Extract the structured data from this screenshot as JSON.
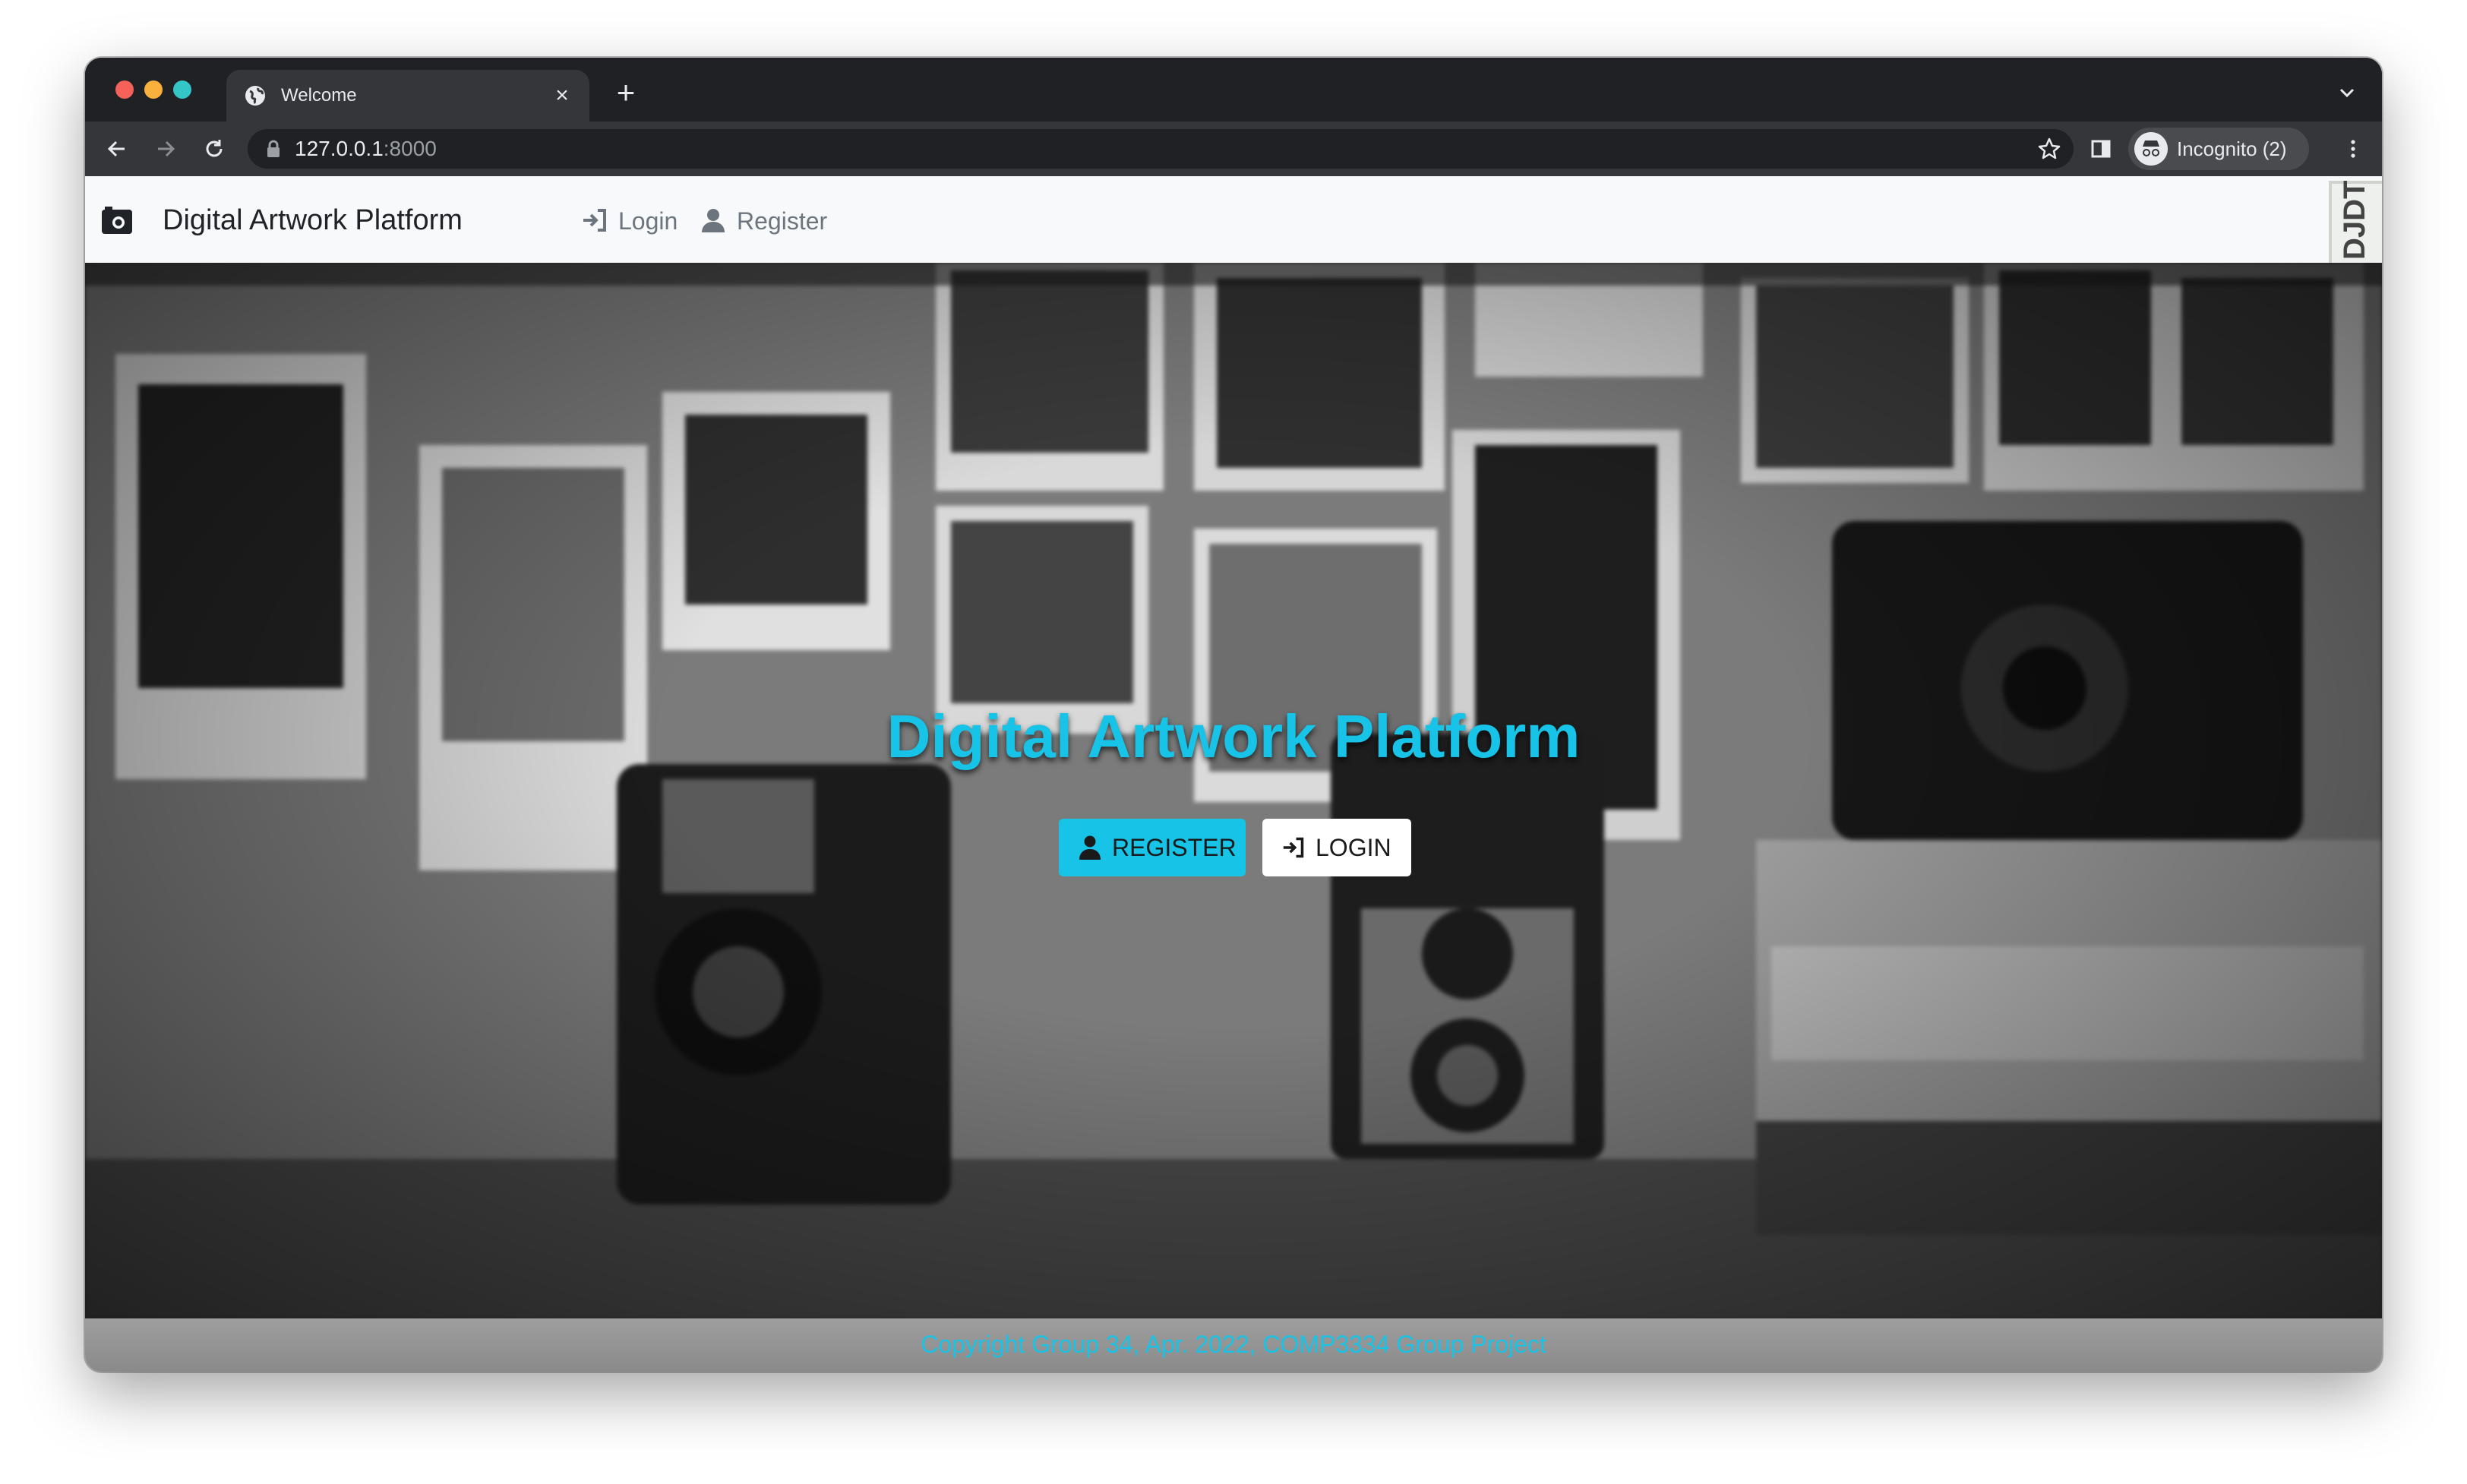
{
  "browser": {
    "tab_title": "Welcome",
    "close_glyph": "×",
    "new_tab_glyph": "+",
    "url_host": "127.0.0.1",
    "url_port": ":8000",
    "profile_label": "Incognito (2)",
    "traffic_colors": [
      "#f6625a",
      "#f9b03c",
      "#34c6c6"
    ]
  },
  "navbar": {
    "brand": "Digital Artwork Platform",
    "login_label": "Login",
    "register_label": "Register",
    "debug_toolbar_label": "DJDT"
  },
  "hero": {
    "title": "Digital Artwork Platform",
    "register_button": "REGISTER",
    "login_button": "LOGIN",
    "background": "blurred black-and-white photo of vintage cameras in front of a wall of pinned photographs"
  },
  "footer": {
    "text": "Copyright Group 34, Apr. 2022, COMP3334 Group Project"
  },
  "colors": {
    "accent": "#17c3e6",
    "navbar_bg": "#f8f9fa",
    "chrome_dark": "#202124",
    "chrome_toolbar": "#35363a"
  }
}
